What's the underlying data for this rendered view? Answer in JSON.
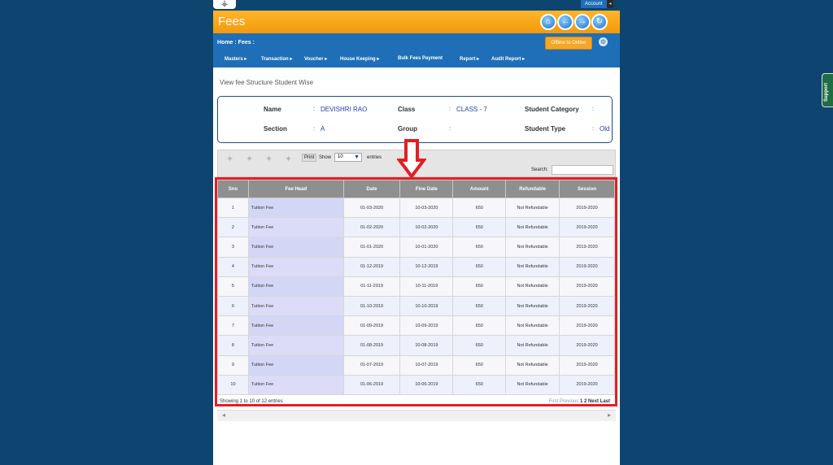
{
  "topbar": {
    "account_label": "Account",
    "account_caret": "◂"
  },
  "header": {
    "title": "Fees",
    "icons": [
      "home-icon",
      "back-icon",
      "forward-icon",
      "refresh-icon"
    ]
  },
  "navbar": {
    "breadcrumb": "Home : Fees :",
    "offline_label": "Offline to Online",
    "menu": [
      "Masters ▸",
      "Transaction ▸",
      "Voucher ▸",
      "House Keeping ▸",
      "Bulk Fees Payment",
      "Report ▸",
      "Audit Report ▸"
    ]
  },
  "subtitle": "View fee Structure Student Wise",
  "student": {
    "name_label": "Name",
    "name": "DEVISHRI RAO",
    "class_label": "Class",
    "class": "CLASS - 7",
    "category_label": "Student Category",
    "category": "",
    "section_label": "Section",
    "section": "A",
    "group_label": "Group",
    "group": "",
    "type_label": "Student Type",
    "type": "Old"
  },
  "toolbar": {
    "print_label": "Print",
    "show_label": "Show",
    "entries_value": "10",
    "entries_label": "entries",
    "search_label": "Search:"
  },
  "table": {
    "columns": [
      "Sno",
      "Fee Head",
      "Date",
      "Fine Date",
      "Amount",
      "Refundable",
      "Session"
    ],
    "rows": [
      [
        "1",
        "Tuition Fee",
        "01-03-2020",
        "10-03-2020",
        "650",
        "Not Refundable",
        "2019-2020"
      ],
      [
        "2",
        "Tuition Fee",
        "01-02-2020",
        "10-02-2020",
        "650",
        "Not Refundable",
        "2019-2020"
      ],
      [
        "3",
        "Tuition Fee",
        "01-01-2020",
        "10-01-2020",
        "650",
        "Not Refundable",
        "2019-2020"
      ],
      [
        "4",
        "Tuition Fee",
        "01-12-2019",
        "10-12-2019",
        "650",
        "Not Refundable",
        "2019-2020"
      ],
      [
        "5",
        "Tuition Fee",
        "01-11-2019",
        "10-11-2019",
        "650",
        "Not Refundable",
        "2019-2020"
      ],
      [
        "6",
        "Tuition Fee",
        "01-10-2019",
        "10-10-2019",
        "650",
        "Not Refundable",
        "2019-2020"
      ],
      [
        "7",
        "Tuition Fee",
        "01-09-2019",
        "10-09-2019",
        "650",
        "Not Refundable",
        "2019-2020"
      ],
      [
        "8",
        "Tuition Fee",
        "01-08-2019",
        "10-08-2019",
        "650",
        "Not Refundable",
        "2019-2020"
      ],
      [
        "9",
        "Tuition Fee",
        "01-07-2019",
        "10-07-2019",
        "650",
        "Not Refundable",
        "2019-2020"
      ],
      [
        "10",
        "Tuition Fee",
        "01-06-2019",
        "10-06-2019",
        "650",
        "Not Refundable",
        "2019-2020"
      ]
    ],
    "footer_info": "Showing 1 to 10 of 12 entries",
    "pagination": {
      "first": "First",
      "previous": "Previous",
      "page1": "1",
      "page2": "2",
      "next": "Next",
      "last": "Last"
    }
  },
  "support_label": "Support",
  "colors": {
    "page_bg": "#0e4470",
    "header_orange": "#f39a0c",
    "nav_blue": "#1e6fb8",
    "highlight_red": "#e31e24"
  }
}
